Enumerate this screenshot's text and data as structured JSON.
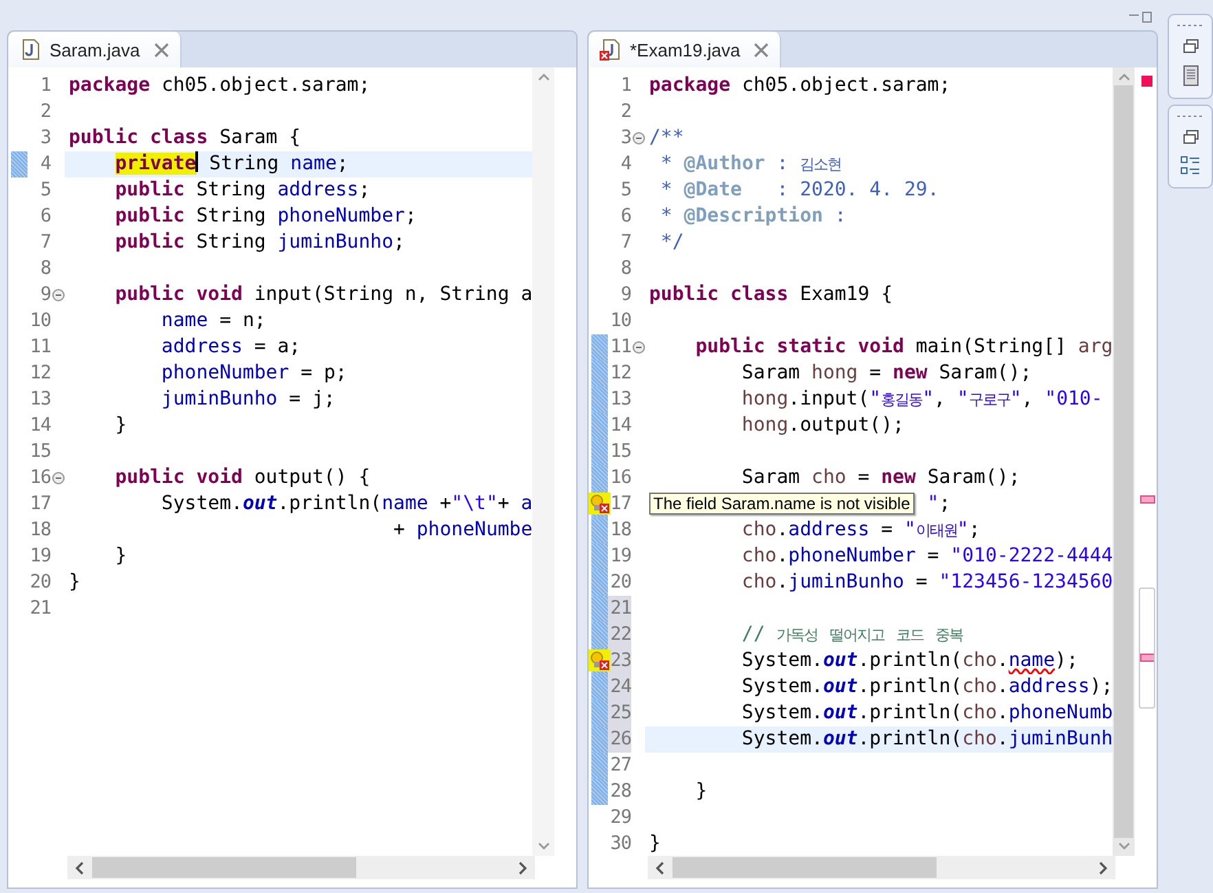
{
  "editors": [
    {
      "tab": {
        "title": "Saram.java",
        "error": false
      },
      "lines": [
        {
          "n": "1",
          "changed": false,
          "shaded": false,
          "fold": false,
          "current": false,
          "error": false,
          "tokens": [
            {
              "text": "package ",
              "kind": "kw"
            },
            {
              "text": "ch05.object.saram;",
              "kind": "plain"
            }
          ]
        },
        {
          "n": "2",
          "changed": false,
          "shaded": false,
          "fold": false,
          "current": false,
          "error": false
        },
        {
          "n": "3",
          "changed": false,
          "shaded": false,
          "fold": false,
          "current": false,
          "error": false,
          "tokens": [
            {
              "text": "public class ",
              "kind": "kw"
            },
            {
              "text": "Saram {",
              "kind": "plain"
            }
          ]
        },
        {
          "n": "4",
          "changed": true,
          "shaded": false,
          "fold": false,
          "current": true,
          "error": false,
          "tokens": [
            {
              "text": "    private",
              "kind": "occurrence"
            },
            {
              "text": " String ",
              "kind": "plain"
            },
            {
              "text": "name",
              "kind": "field"
            },
            {
              "text": ";",
              "kind": "plain"
            }
          ]
        },
        {
          "n": "5",
          "changed": false,
          "shaded": false,
          "fold": false,
          "current": false,
          "error": false,
          "tokens": [
            {
              "text": "    public",
              "kind": "kw"
            },
            {
              "text": " String ",
              "kind": "plain"
            },
            {
              "text": "address",
              "kind": "field"
            },
            {
              "text": ";",
              "kind": "plain"
            }
          ]
        },
        {
          "n": "6",
          "changed": false,
          "shaded": false,
          "fold": false,
          "current": false,
          "error": false,
          "tokens": [
            {
              "text": "    public",
              "kind": "kw"
            },
            {
              "text": " String ",
              "kind": "plain"
            },
            {
              "text": "phoneNumber",
              "kind": "field"
            },
            {
              "text": ";",
              "kind": "plain"
            }
          ]
        },
        {
          "n": "7",
          "changed": false,
          "shaded": false,
          "fold": false,
          "current": false,
          "error": false,
          "tokens": [
            {
              "text": "    public",
              "kind": "kw"
            },
            {
              "text": " String ",
              "kind": "plain"
            },
            {
              "text": "juminBunho",
              "kind": "field"
            },
            {
              "text": ";",
              "kind": "plain"
            }
          ]
        },
        {
          "n": "8",
          "changed": false,
          "shaded": false,
          "fold": false,
          "current": false,
          "error": false
        },
        {
          "n": "9",
          "changed": false,
          "shaded": false,
          "fold": true,
          "current": false,
          "error": false,
          "tokens": [
            {
              "text": "    public void ",
              "kind": "kw"
            },
            {
              "text": "input(String n, String a",
              "kind": "plain"
            }
          ]
        },
        {
          "n": "10",
          "changed": false,
          "shaded": false,
          "fold": false,
          "current": false,
          "error": false,
          "tokens": [
            {
              "text": "        name",
              "kind": "field"
            },
            {
              "text": " = n;",
              "kind": "plain"
            }
          ]
        },
        {
          "n": "11",
          "changed": false,
          "shaded": false,
          "fold": false,
          "current": false,
          "error": false,
          "tokens": [
            {
              "text": "        address",
              "kind": "field"
            },
            {
              "text": " = a;",
              "kind": "plain"
            }
          ]
        },
        {
          "n": "12",
          "changed": false,
          "shaded": false,
          "fold": false,
          "current": false,
          "error": false,
          "tokens": [
            {
              "text": "        phoneNumber",
              "kind": "field"
            },
            {
              "text": " = p;",
              "kind": "plain"
            }
          ]
        },
        {
          "n": "13",
          "changed": false,
          "shaded": false,
          "fold": false,
          "current": false,
          "error": false,
          "tokens": [
            {
              "text": "        juminBunho",
              "kind": "field"
            },
            {
              "text": " = j;",
              "kind": "plain"
            }
          ]
        },
        {
          "n": "14",
          "changed": false,
          "shaded": false,
          "fold": false,
          "current": false,
          "error": false,
          "tokens": [
            {
              "text": "    }",
              "kind": "plain"
            }
          ]
        },
        {
          "n": "15",
          "changed": false,
          "shaded": false,
          "fold": false,
          "current": false,
          "error": false
        },
        {
          "n": "16",
          "changed": false,
          "shaded": false,
          "fold": true,
          "current": false,
          "error": false,
          "tokens": [
            {
              "text": "    public void ",
              "kind": "kw"
            },
            {
              "text": "output() {",
              "kind": "plain"
            }
          ]
        },
        {
          "n": "17",
          "changed": false,
          "shaded": false,
          "fold": false,
          "current": false,
          "error": false,
          "tokens": [
            {
              "text": "        System.",
              "kind": "plain"
            },
            {
              "text": "out",
              "kind": "static"
            },
            {
              "text": ".println(",
              "kind": "plain"
            },
            {
              "text": "name",
              "kind": "field"
            },
            {
              "text": " +",
              "kind": "plain"
            },
            {
              "text": "\"\\t\"",
              "kind": "string"
            },
            {
              "text": "+ ",
              "kind": "plain"
            },
            {
              "text": "a",
              "kind": "field"
            }
          ]
        },
        {
          "n": "18",
          "changed": false,
          "shaded": false,
          "fold": false,
          "current": false,
          "error": false,
          "tokens": [
            {
              "text": "                            + ",
              "kind": "plain"
            },
            {
              "text": "phoneNumbe",
              "kind": "field"
            }
          ]
        },
        {
          "n": "19",
          "changed": false,
          "shaded": false,
          "fold": false,
          "current": false,
          "error": false,
          "tokens": [
            {
              "text": "    }",
              "kind": "plain"
            }
          ]
        },
        {
          "n": "20",
          "changed": false,
          "shaded": false,
          "fold": false,
          "current": false,
          "error": false,
          "tokens": [
            {
              "text": "}",
              "kind": "plain"
            }
          ]
        },
        {
          "n": "21",
          "changed": false,
          "shaded": false,
          "fold": false,
          "current": false,
          "error": false
        }
      ]
    },
    {
      "tab": {
        "title": "*Exam19.java",
        "error": true
      },
      "lines": [
        {
          "n": "1",
          "changed": false,
          "shaded": false,
          "fold": false,
          "current": false,
          "error": false,
          "tokens": [
            {
              "text": "package ",
              "kind": "kw"
            },
            {
              "text": "ch05.object.saram;",
              "kind": "plain"
            }
          ]
        },
        {
          "n": "2",
          "changed": false,
          "shaded": false,
          "fold": false,
          "current": false,
          "error": false
        },
        {
          "n": "3",
          "changed": false,
          "shaded": false,
          "fold": true,
          "current": false,
          "error": false,
          "tokens": [
            {
              "text": "/**",
              "kind": "doc"
            }
          ]
        },
        {
          "n": "4",
          "changed": false,
          "shaded": false,
          "fold": false,
          "current": false,
          "error": false,
          "tokens": [
            {
              "text": " * ",
              "kind": "doc"
            },
            {
              "text": "@Author",
              "kind": "doctag"
            },
            {
              "text": " : 김소현",
              "kind": "doc"
            }
          ]
        },
        {
          "n": "5",
          "changed": false,
          "shaded": false,
          "fold": false,
          "current": false,
          "error": false,
          "tokens": [
            {
              "text": " * ",
              "kind": "doc"
            },
            {
              "text": "@Date",
              "kind": "doctag"
            },
            {
              "text": "   : 2020. 4. 29.",
              "kind": "doc"
            }
          ]
        },
        {
          "n": "6",
          "changed": false,
          "shaded": false,
          "fold": false,
          "current": false,
          "error": false,
          "tokens": [
            {
              "text": " * ",
              "kind": "doc"
            },
            {
              "text": "@Description",
              "kind": "doctag"
            },
            {
              "text": " :",
              "kind": "doc"
            }
          ]
        },
        {
          "n": "7",
          "changed": false,
          "shaded": false,
          "fold": false,
          "current": false,
          "error": false,
          "tokens": [
            {
              "text": " */",
              "kind": "doc"
            }
          ]
        },
        {
          "n": "8",
          "changed": false,
          "shaded": false,
          "fold": false,
          "current": false,
          "error": false
        },
        {
          "n": "9",
          "changed": false,
          "shaded": false,
          "fold": false,
          "current": false,
          "error": false,
          "tokens": [
            {
              "text": "public class ",
              "kind": "kw"
            },
            {
              "text": "Exam19 {",
              "kind": "plain"
            }
          ]
        },
        {
          "n": "10",
          "changed": false,
          "shaded": false,
          "fold": false,
          "current": false,
          "error": false
        },
        {
          "n": "11",
          "changed": true,
          "shaded": false,
          "fold": true,
          "current": false,
          "error": false,
          "tokens": [
            {
              "text": "    public static void ",
              "kind": "kw"
            },
            {
              "text": "main(String[] ",
              "kind": "plain"
            },
            {
              "text": "arg",
              "kind": "local"
            }
          ]
        },
        {
          "n": "12",
          "changed": true,
          "shaded": false,
          "fold": false,
          "current": false,
          "error": false,
          "tokens": [
            {
              "text": "        Saram ",
              "kind": "plain"
            },
            {
              "text": "hong",
              "kind": "local"
            },
            {
              "text": " = ",
              "kind": "plain"
            },
            {
              "text": "new",
              "kind": "kw"
            },
            {
              "text": " Saram();",
              "kind": "plain"
            }
          ]
        },
        {
          "n": "13",
          "changed": true,
          "shaded": false,
          "fold": false,
          "current": false,
          "error": false,
          "tokens": [
            {
              "text": "        hong",
              "kind": "local"
            },
            {
              "text": ".input(",
              "kind": "plain"
            },
            {
              "text": "\"홍길동\"",
              "kind": "string"
            },
            {
              "text": ", ",
              "kind": "plain"
            },
            {
              "text": "\"구로구\"",
              "kind": "string"
            },
            {
              "text": ", ",
              "kind": "plain"
            },
            {
              "text": "\"010-",
              "kind": "string"
            }
          ]
        },
        {
          "n": "14",
          "changed": true,
          "shaded": false,
          "fold": false,
          "current": false,
          "error": false,
          "tokens": [
            {
              "text": "        hong",
              "kind": "local"
            },
            {
              "text": ".output();",
              "kind": "plain"
            }
          ]
        },
        {
          "n": "15",
          "changed": true,
          "shaded": false,
          "fold": false,
          "current": false,
          "error": false
        },
        {
          "n": "16",
          "changed": true,
          "shaded": false,
          "fold": false,
          "current": false,
          "error": false,
          "tokens": [
            {
              "text": "        Saram ",
              "kind": "plain"
            },
            {
              "text": "cho",
              "kind": "local"
            },
            {
              "text": " = ",
              "kind": "plain"
            },
            {
              "text": "new",
              "kind": "kw"
            },
            {
              "text": " Saram();",
              "kind": "plain"
            }
          ]
        },
        {
          "n": "17",
          "changed": true,
          "shaded": false,
          "fold": false,
          "current": false,
          "error": true,
          "tooltip": "The field Saram.name is not visible",
          "tokens": [
            {
              "text": "\"",
              "kind": "string"
            },
            {
              "text": ";",
              "kind": "plain"
            }
          ]
        },
        {
          "n": "18",
          "changed": true,
          "shaded": false,
          "fold": false,
          "current": false,
          "error": false,
          "tokens": [
            {
              "text": "        cho",
              "kind": "local"
            },
            {
              "text": ".",
              "kind": "plain"
            },
            {
              "text": "address",
              "kind": "field"
            },
            {
              "text": " = ",
              "kind": "plain"
            },
            {
              "text": "\"이태원\"",
              "kind": "string"
            },
            {
              "text": ";",
              "kind": "plain"
            }
          ]
        },
        {
          "n": "19",
          "changed": true,
          "shaded": false,
          "fold": false,
          "current": false,
          "error": false,
          "tokens": [
            {
              "text": "        cho",
              "kind": "local"
            },
            {
              "text": ".",
              "kind": "plain"
            },
            {
              "text": "phoneNumber",
              "kind": "field"
            },
            {
              "text": " = ",
              "kind": "plain"
            },
            {
              "text": "\"010-2222-4444",
              "kind": "string"
            }
          ]
        },
        {
          "n": "20",
          "changed": true,
          "shaded": false,
          "fold": false,
          "current": false,
          "error": false,
          "tokens": [
            {
              "text": "        cho",
              "kind": "local"
            },
            {
              "text": ".",
              "kind": "plain"
            },
            {
              "text": "juminBunho",
              "kind": "field"
            },
            {
              "text": " = ",
              "kind": "plain"
            },
            {
              "text": "\"123456-1234560",
              "kind": "string"
            }
          ]
        },
        {
          "n": "21",
          "changed": true,
          "shaded": true,
          "fold": false,
          "current": false,
          "error": false
        },
        {
          "n": "22",
          "changed": true,
          "shaded": true,
          "fold": false,
          "current": false,
          "error": false,
          "tokens": [
            {
              "text": "        // 가독성 떨어지고 코드 중복",
              "kind": "comment"
            }
          ]
        },
        {
          "n": "23",
          "changed": true,
          "shaded": true,
          "fold": false,
          "current": false,
          "error": true,
          "tokens": [
            {
              "text": "        System.",
              "kind": "plain"
            },
            {
              "text": "out",
              "kind": "static"
            },
            {
              "text": ".println(",
              "kind": "plain"
            },
            {
              "text": "cho",
              "kind": "local"
            },
            {
              "text": ".",
              "kind": "plain"
            },
            {
              "text": "name",
              "kind": "error"
            },
            {
              "text": ");",
              "kind": "plain"
            }
          ]
        },
        {
          "n": "24",
          "changed": true,
          "shaded": true,
          "fold": false,
          "current": false,
          "error": false,
          "tokens": [
            {
              "text": "        System.",
              "kind": "plain"
            },
            {
              "text": "out",
              "kind": "static"
            },
            {
              "text": ".println(",
              "kind": "plain"
            },
            {
              "text": "cho",
              "kind": "local"
            },
            {
              "text": ".",
              "kind": "plain"
            },
            {
              "text": "address",
              "kind": "field"
            },
            {
              "text": ");",
              "kind": "plain"
            }
          ]
        },
        {
          "n": "25",
          "changed": true,
          "shaded": true,
          "fold": false,
          "current": false,
          "error": false,
          "tokens": [
            {
              "text": "        System.",
              "kind": "plain"
            },
            {
              "text": "out",
              "kind": "static"
            },
            {
              "text": ".println(",
              "kind": "plain"
            },
            {
              "text": "cho",
              "kind": "local"
            },
            {
              "text": ".",
              "kind": "plain"
            },
            {
              "text": "phoneNumb",
              "kind": "field"
            }
          ]
        },
        {
          "n": "26",
          "changed": true,
          "shaded": true,
          "fold": false,
          "current": true,
          "error": false,
          "tokens": [
            {
              "text": "        System.",
              "kind": "plain"
            },
            {
              "text": "out",
              "kind": "static"
            },
            {
              "text": ".println(",
              "kind": "plain"
            },
            {
              "text": "cho",
              "kind": "local"
            },
            {
              "text": ".",
              "kind": "plain"
            },
            {
              "text": "juminBunh",
              "kind": "field"
            }
          ]
        },
        {
          "n": "27",
          "changed": true,
          "shaded": false,
          "fold": false,
          "current": false,
          "error": false
        },
        {
          "n": "28",
          "changed": true,
          "shaded": false,
          "fold": false,
          "current": false,
          "error": false,
          "tokens": [
            {
              "text": "    }",
              "kind": "plain"
            }
          ]
        },
        {
          "n": "29",
          "changed": false,
          "shaded": false,
          "fold": false,
          "current": false,
          "error": false
        },
        {
          "n": "30",
          "changed": false,
          "shaded": false,
          "fold": false,
          "current": false,
          "error": false,
          "tokens": [
            {
              "text": "}",
              "kind": "plain"
            }
          ]
        }
      ]
    }
  ]
}
